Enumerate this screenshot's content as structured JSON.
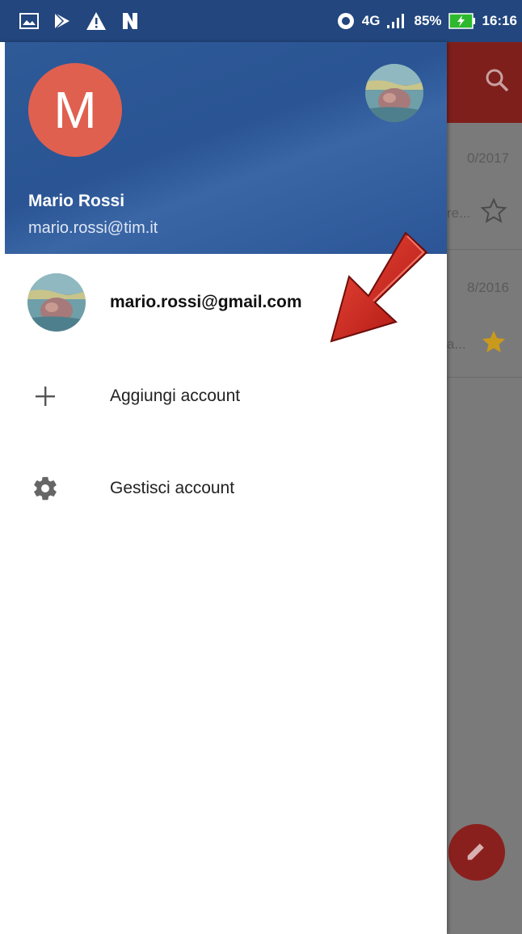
{
  "status_bar": {
    "network": "4G",
    "battery": "85%",
    "time": "16:16",
    "left_icons": [
      "gallery-icon",
      "play-store-icon",
      "warning-icon",
      "n-app-icon"
    ]
  },
  "drawer": {
    "header": {
      "avatar_letter": "M",
      "name": "Mario Rossi",
      "email": "mario.rossi@tim.it"
    },
    "items": [
      {
        "label": "mario.rossi@gmail.com",
        "icon": "account-photo"
      },
      {
        "label": "Aggiungi account",
        "icon": "plus-icon"
      },
      {
        "label": "Gestisci account",
        "icon": "gear-icon"
      }
    ]
  },
  "background_list": {
    "rows": [
      {
        "date": "0/2017",
        "snippet": "re...",
        "starred": false
      },
      {
        "date": "8/2016",
        "snippet": "a...",
        "starred": true
      }
    ]
  },
  "colors": {
    "header_blue": "#2a5493",
    "status_bar": "#22467d",
    "avatar_red": "#e06050",
    "arrow_red": "#d0201a",
    "star_gold": "#c99a1c"
  }
}
